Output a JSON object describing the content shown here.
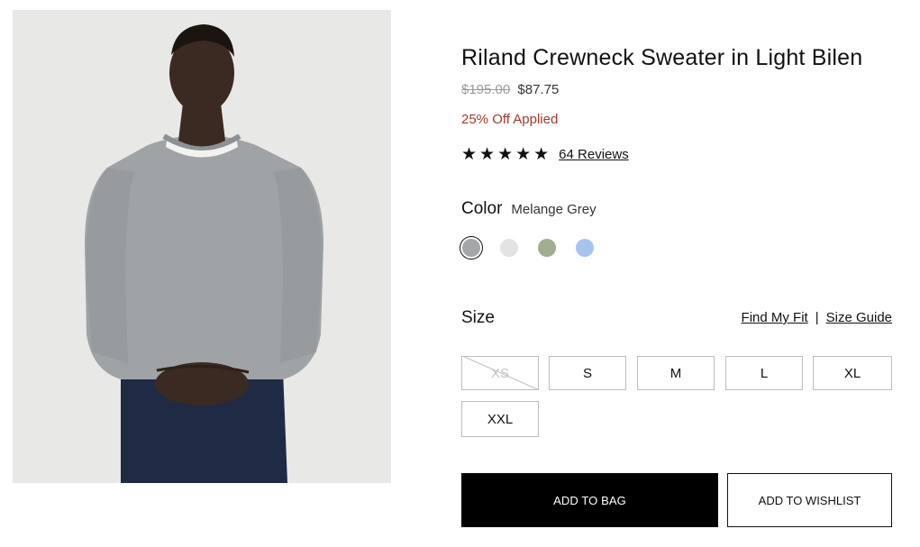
{
  "product": {
    "title": "Riland Crewneck Sweater in Light Bilen",
    "original_price": "$195.00",
    "sale_price": "$87.75",
    "discount_text": "25% Off Applied",
    "rating_stars": "★★★★★",
    "rating_value": 5,
    "reviews_link": "64 Reviews"
  },
  "color": {
    "label": "Color",
    "selected_value": "Melange Grey",
    "swatches": [
      {
        "color": "#a3a7aa",
        "selected": true
      },
      {
        "color": "#e3e3e3",
        "selected": false
      },
      {
        "color": "#a2ad91",
        "selected": false
      },
      {
        "color": "#a7c4ee",
        "selected": false
      }
    ]
  },
  "size": {
    "label": "Size",
    "find_my_fit": "Find My Fit",
    "separator": "|",
    "size_guide": "Size Guide",
    "options": [
      {
        "label": "XS",
        "available": false
      },
      {
        "label": "S",
        "available": true
      },
      {
        "label": "M",
        "available": true
      },
      {
        "label": "L",
        "available": true
      },
      {
        "label": "XL",
        "available": true
      },
      {
        "label": "XXL",
        "available": true
      }
    ]
  },
  "actions": {
    "add_to_bag": "ADD TO BAG",
    "add_to_wishlist": "ADD TO WISHLIST"
  },
  "colors": {
    "discount": "#a33a2c",
    "primary_button": "#000000",
    "image_background": "#e7e8e5"
  }
}
